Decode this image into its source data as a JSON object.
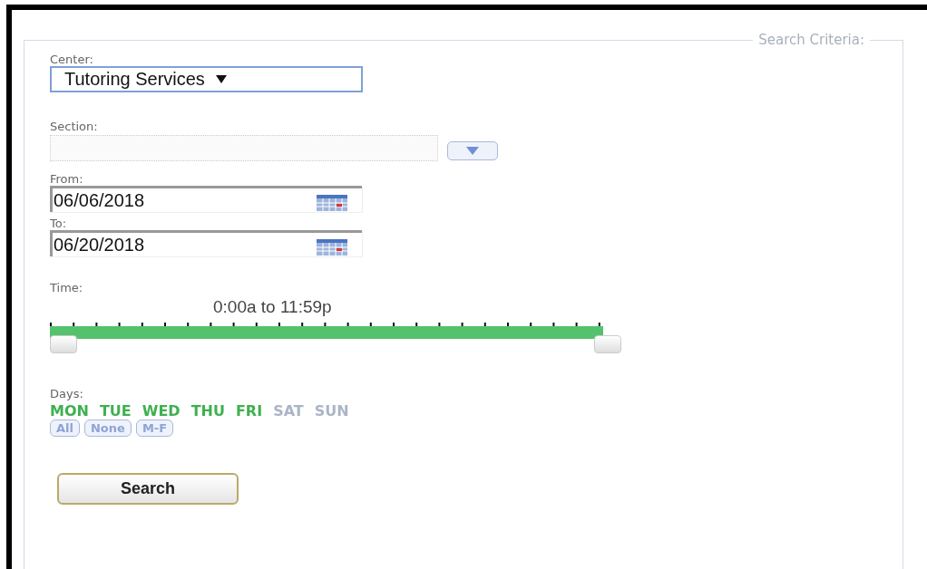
{
  "panel": {
    "legend": "Search Criteria:"
  },
  "center": {
    "label": "Center:",
    "value": "Tutoring Services"
  },
  "section": {
    "label": "Section:",
    "disabled": true
  },
  "from": {
    "label": "From:",
    "value": "06/06/2018"
  },
  "to": {
    "label": "To:",
    "value": "06/20/2018"
  },
  "time": {
    "label": "Time:",
    "reading": "0:00a to 11:59p",
    "thumbs": [
      {
        "level": 0
      },
      {
        "level": 1
      }
    ]
  },
  "days": {
    "label": "Days:",
    "items": [
      {
        "label": "MON",
        "selected": true
      },
      {
        "label": "TUE",
        "selected": true
      },
      {
        "label": "WED",
        "selected": true
      },
      {
        "label": "THU",
        "selected": true
      },
      {
        "label": "FRI",
        "selected": true
      },
      {
        "label": "SAT",
        "selected": false
      },
      {
        "label": "SUN",
        "selected": false
      }
    ],
    "buttons": [
      "All",
      "None",
      "M-F"
    ]
  },
  "search_button": "Search"
}
